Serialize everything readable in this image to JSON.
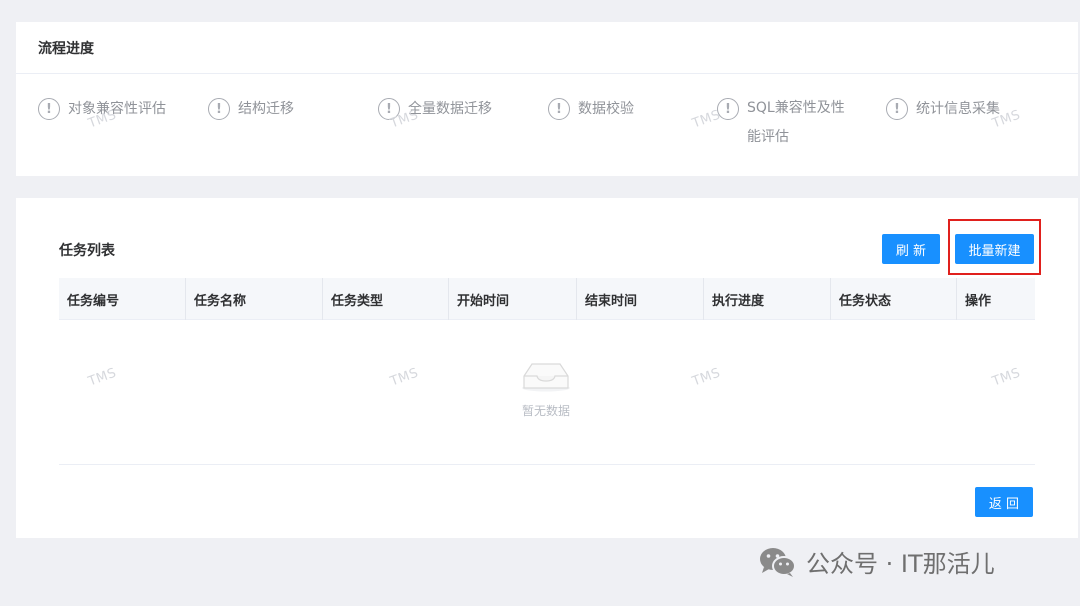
{
  "progress": {
    "title": "流程进度",
    "steps": [
      {
        "label": "对象兼容性评估",
        "icon": "exclamation-circle-icon"
      },
      {
        "label": "结构迁移",
        "icon": "exclamation-circle-icon"
      },
      {
        "label": "全量数据迁移",
        "icon": "exclamation-circle-icon"
      },
      {
        "label": "数据校验",
        "icon": "exclamation-circle-icon"
      },
      {
        "label": "SQL兼容性及性能评估",
        "icon": "exclamation-circle-icon"
      },
      {
        "label": "统计信息采集",
        "icon": "exclamation-circle-icon"
      }
    ],
    "step_icon_glyph": "!"
  },
  "tasks": {
    "title": "任务列表",
    "refresh_label": "刷 新",
    "batch_create_label": "批量新建",
    "columns": [
      "任务编号",
      "任务名称",
      "任务类型",
      "开始时间",
      "结束时间",
      "执行进度",
      "任务状态",
      "操作"
    ],
    "empty_text": "暂无数据",
    "back_label": "返 回"
  },
  "watermark": "TMS",
  "footer": {
    "text": "公众号 · IT那活儿"
  },
  "colors": {
    "primary": "#1890ff",
    "highlight": "#e0201d",
    "background": "#eff0f4"
  }
}
